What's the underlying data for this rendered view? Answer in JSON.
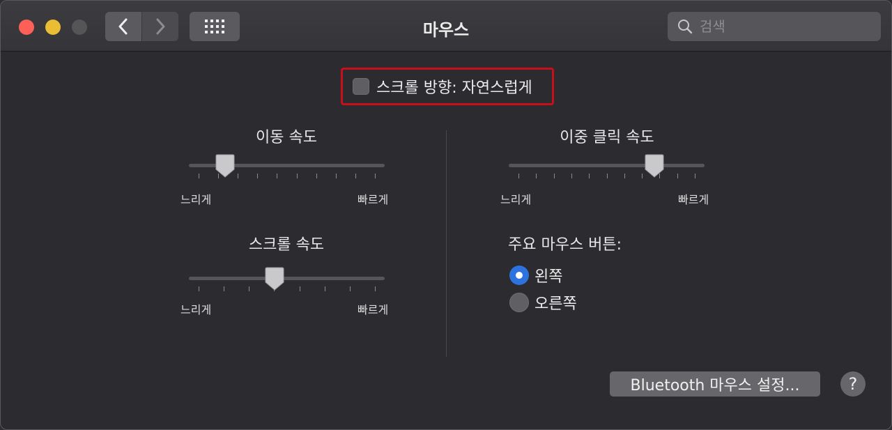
{
  "window": {
    "title": "마우스"
  },
  "toolbar": {
    "search_placeholder": "검색"
  },
  "scroll_direction": {
    "label": "스크롤 방향: 자연스럽게",
    "checked": false
  },
  "tracking_speed": {
    "title": "이동 속도",
    "min_label": "느리게",
    "max_label": "빠르게",
    "value_fraction": 0.15,
    "tick_count": 10
  },
  "scroll_speed": {
    "title": "스크롤 속도",
    "min_label": "느리게",
    "max_label": "빠르게",
    "value_fraction": 0.43,
    "tick_count": 8
  },
  "double_click_speed": {
    "title": "이중 클릭 속도",
    "min_label": "느리게",
    "max_label": "빠르게",
    "value_fraction": 0.77,
    "tick_count": 11
  },
  "primary_button": {
    "title": "주요 마우스 버튼:",
    "options": [
      {
        "label": "왼쪽",
        "selected": true
      },
      {
        "label": "오른쪽",
        "selected": false
      }
    ]
  },
  "bluetooth_button": {
    "label": "Bluetooth 마우스 설정..."
  },
  "help_button": {
    "label": "?"
  },
  "colors": {
    "accent": "#2d73e0",
    "highlight_border": "#c8101a"
  }
}
